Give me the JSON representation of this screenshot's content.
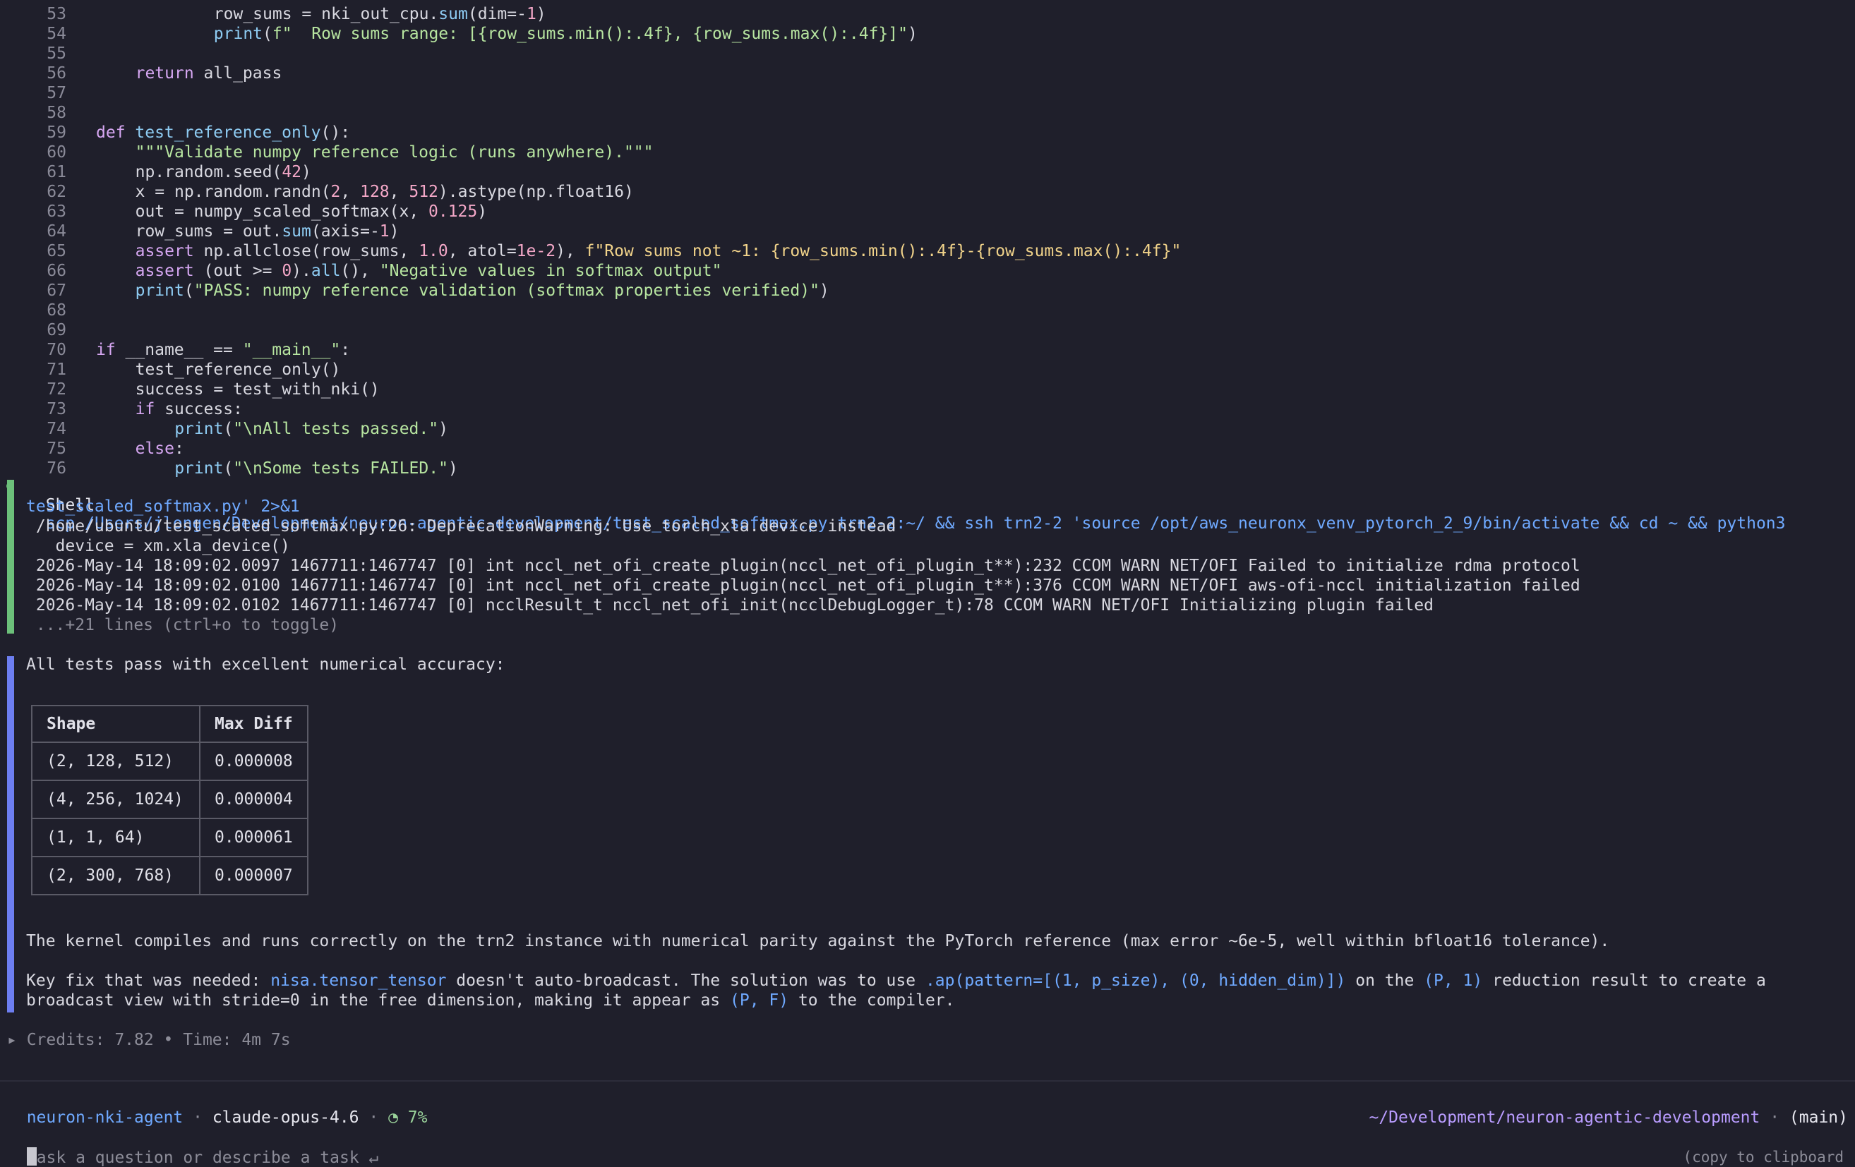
{
  "code_lines": [
    {
      "n": "53",
      "i": 6,
      "t": [
        [
          "",
          "row_sums = nki_out_cpu."
        ],
        [
          "fn",
          "sum"
        ],
        [
          "",
          "(dim=-"
        ],
        [
          "num",
          "1"
        ],
        [
          "",
          ")"
        ]
      ]
    },
    {
      "n": "54",
      "i": 6,
      "t": [
        [
          "fn",
          "print"
        ],
        [
          "",
          "("
        ],
        [
          "str",
          "f\"  Row sums range: [{row_sums.min():.4f}, {row_sums.max():.4f}]\""
        ],
        [
          "",
          ")"
        ]
      ]
    },
    {
      "n": "55",
      "i": 0,
      "t": []
    },
    {
      "n": "56",
      "i": 2,
      "t": [
        [
          "kw",
          "return"
        ],
        [
          "",
          " all_pass"
        ]
      ]
    },
    {
      "n": "57",
      "i": 0,
      "t": []
    },
    {
      "n": "58",
      "i": 0,
      "t": []
    },
    {
      "n": "59",
      "i": 0,
      "t": [
        [
          "kw",
          "def"
        ],
        [
          "",
          ""
        ],
        [
          "fn",
          " test_reference_only"
        ],
        [
          "",
          "():"
        ]
      ]
    },
    {
      "n": "60",
      "i": 2,
      "t": [
        [
          "str",
          "\"\"\"Validate numpy reference logic (runs anywhere).\"\"\""
        ]
      ]
    },
    {
      "n": "61",
      "i": 2,
      "t": [
        [
          "",
          "np.random.seed("
        ],
        [
          "num",
          "42"
        ],
        [
          "",
          ")"
        ]
      ]
    },
    {
      "n": "62",
      "i": 2,
      "t": [
        [
          "",
          "x = np.random.randn("
        ],
        [
          "num",
          "2"
        ],
        [
          "",
          ", "
        ],
        [
          "num",
          "128"
        ],
        [
          "",
          ", "
        ],
        [
          "num",
          "512"
        ],
        [
          "",
          ").astype(np.float16)"
        ]
      ]
    },
    {
      "n": "63",
      "i": 2,
      "t": [
        [
          "",
          "out = numpy_scaled_softmax(x, "
        ],
        [
          "num",
          "0.125"
        ],
        [
          "",
          ")"
        ]
      ]
    },
    {
      "n": "64",
      "i": 2,
      "t": [
        [
          "",
          "row_sums = out."
        ],
        [
          "fn",
          "sum"
        ],
        [
          "",
          "(axis=-"
        ],
        [
          "num",
          "1"
        ],
        [
          "",
          ")"
        ]
      ]
    },
    {
      "n": "65",
      "i": 2,
      "t": [
        [
          "kw",
          "assert"
        ],
        [
          "",
          " np.allclose(row_sums, "
        ],
        [
          "num",
          "1.0"
        ],
        [
          "",
          ", atol="
        ],
        [
          "num",
          "1e-2"
        ],
        [
          "",
          "), "
        ],
        [
          "fs",
          "f\"Row sums not ~1: {row_sums.min():.4f}-{row_sums.max():.4f}\""
        ]
      ]
    },
    {
      "n": "66",
      "i": 2,
      "t": [
        [
          "kw",
          "assert"
        ],
        [
          "",
          " (out >= "
        ],
        [
          "num",
          "0"
        ],
        [
          "",
          ")."
        ],
        [
          "fn",
          "all"
        ],
        [
          "",
          "(), "
        ],
        [
          "str",
          "\"Negative values in softmax output\""
        ]
      ]
    },
    {
      "n": "67",
      "i": 2,
      "t": [
        [
          "fn",
          "print"
        ],
        [
          "",
          "("
        ],
        [
          "str",
          "\"PASS: numpy reference validation (softmax properties verified)\""
        ],
        [
          "",
          ")"
        ]
      ]
    },
    {
      "n": "68",
      "i": 0,
      "t": []
    },
    {
      "n": "69",
      "i": 0,
      "t": []
    },
    {
      "n": "70",
      "i": 0,
      "t": [
        [
          "kw",
          "if"
        ],
        [
          "",
          " __name__ == "
        ],
        [
          "str",
          "\"__main__\""
        ],
        [
          "",
          ":"
        ]
      ]
    },
    {
      "n": "71",
      "i": 2,
      "t": [
        [
          "",
          "test_reference_only()"
        ]
      ]
    },
    {
      "n": "72",
      "i": 2,
      "t": [
        [
          "",
          "success = test_with_nki()"
        ]
      ]
    },
    {
      "n": "73",
      "i": 2,
      "t": [
        [
          "kw",
          "if"
        ],
        [
          "",
          " success:"
        ]
      ]
    },
    {
      "n": "74",
      "i": 4,
      "t": [
        [
          "fn",
          "print"
        ],
        [
          "",
          "("
        ],
        [
          "str",
          "\"\\nAll tests passed.\""
        ],
        [
          "",
          ")"
        ]
      ]
    },
    {
      "n": "75",
      "i": 2,
      "t": [
        [
          "kw",
          "else"
        ],
        [
          "",
          ":"
        ]
      ]
    },
    {
      "n": "76",
      "i": 4,
      "t": [
        [
          "fn",
          "print"
        ],
        [
          "",
          "("
        ],
        [
          "str",
          "\"\\nSome tests FAILED.\""
        ],
        [
          "",
          ")"
        ]
      ]
    }
  ],
  "shell": {
    "label": "Shell",
    "command_line1": "scp /Users/jlongen/Development/neuron-agentic-development/test_scaled_softmax.py trn2-2:~/ && ssh trn2-2 'source /opt/aws_neuronx_venv_pytorch_2_9/bin/activate && cd ~ && python3",
    "command_line2": "test_scaled_softmax.py' 2>&1",
    "output": [
      " /home/ubuntu/test_scaled_softmax.py:26: DeprecationWarning: Use torch_xla.device instead",
      "   device = xm.xla_device()",
      " 2026-May-14 18:09:02.0097 1467711:1467747 [0] int nccl_net_ofi_create_plugin(nccl_net_ofi_plugin_t**):232 CCOM WARN NET/OFI Failed to initialize rdma protocol",
      " 2026-May-14 18:09:02.0100 1467711:1467747 [0] int nccl_net_ofi_create_plugin(nccl_net_ofi_plugin_t**):376 CCOM WARN NET/OFI aws-ofi-nccl initialization failed",
      " 2026-May-14 18:09:02.0102 1467711:1467747 [0] ncclResult_t nccl_net_ofi_init(ncclDebugLogger_t):78 CCOM WARN NET/OFI Initializing plugin failed"
    ],
    "toggle_hint": " ...+21 lines (ctrl+o to toggle)"
  },
  "response": {
    "intro": "All tests pass with excellent numerical accuracy:",
    "table_headers": [
      "Shape",
      "Max Diff"
    ],
    "table_rows": [
      [
        "(2, 128, 512)",
        "0.000008"
      ],
      [
        "(4, 256, 1024)",
        "0.000004"
      ],
      [
        "(1, 1, 64)",
        "0.000061"
      ],
      [
        "(2, 300, 768)",
        "0.000007"
      ]
    ],
    "summary": "The kernel compiles and runs correctly on the trn2 instance with numerical parity against the PyTorch reference (max error ~6e-5, well within bfloat16 tolerance).",
    "keyfix_parts": [
      [
        "",
        "Key fix that was needed: "
      ],
      [
        "blue",
        "nisa.tensor_tensor"
      ],
      [
        "",
        " doesn't auto-broadcast. The solution was to use "
      ],
      [
        "blue",
        ".ap(pattern=[(1, p_size), (0, hidden_dim)])"
      ],
      [
        "",
        " on the "
      ],
      [
        "blue",
        "(P, 1)"
      ],
      [
        "",
        " reduction result to create a"
      ]
    ],
    "keyfix_parts2": [
      [
        "",
        "broadcast view with stride=0 in the free dimension, making it appear as "
      ],
      [
        "blue",
        "(P, F)"
      ],
      [
        "",
        " to the compiler."
      ]
    ]
  },
  "credits": "▸ Credits: 7.82 • Time: 4m 7s",
  "statusbar": {
    "agent": "neuron-nki-agent",
    "sep1": " · ",
    "model": "claude-opus-4.6",
    "sep2": " · ",
    "context": "◔ 7%",
    "path": "~/Development/neuron-agentic-development",
    "sep3": " · ",
    "branch": "(main)"
  },
  "prompt": {
    "placeholder": "ask a question or describe a task ↵",
    "copy_hint": "(copy to clipboard"
  },
  "colors": {
    "background": "#1f1f2b",
    "shell_bar": "#6cc07a",
    "response_bar": "#6d7ef0",
    "link_blue": "#6fa9ff"
  }
}
